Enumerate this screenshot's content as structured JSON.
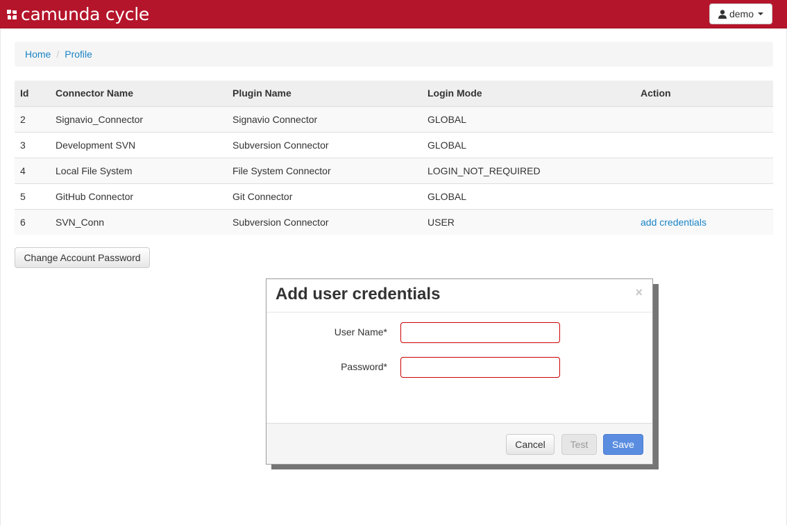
{
  "app": {
    "brand": "camunda cycle",
    "user_menu_label": "demo"
  },
  "breadcrumb": {
    "items": [
      "Home",
      "Profile"
    ]
  },
  "table": {
    "headers": [
      "Id",
      "Connector Name",
      "Plugin Name",
      "Login Mode",
      "Action"
    ],
    "rows": [
      {
        "id": "2",
        "connector": "Signavio_Connector",
        "plugin": "Signavio Connector",
        "login": "GLOBAL",
        "action": ""
      },
      {
        "id": "3",
        "connector": "Development SVN",
        "plugin": "Subversion Connector",
        "login": "GLOBAL",
        "action": ""
      },
      {
        "id": "4",
        "connector": "Local File System",
        "plugin": "File System Connector",
        "login": "LOGIN_NOT_REQUIRED",
        "action": ""
      },
      {
        "id": "5",
        "connector": "GitHub Connector",
        "plugin": "Git Connector",
        "login": "GLOBAL",
        "action": ""
      },
      {
        "id": "6",
        "connector": "SVN_Conn",
        "plugin": "Subversion Connector",
        "login": "USER",
        "action": "add credentials"
      }
    ]
  },
  "change_password_label": "Change Account Password",
  "modal": {
    "title": "Add user credentials",
    "close_glyph": "×",
    "fields": {
      "username_label": "User Name*",
      "username_value": "",
      "password_label": "Password*",
      "password_value": ""
    },
    "buttons": {
      "cancel": "Cancel",
      "test": "Test",
      "save": "Save"
    }
  },
  "colors": {
    "navbar": "#b5152b",
    "link": "#1a84c6",
    "primary_button": "#5a8de0",
    "invalid_border": "#cc0000"
  },
  "icons": {
    "brand": "camunda-logo-icon",
    "user": "user-icon",
    "dropdown": "caret-down-icon"
  }
}
